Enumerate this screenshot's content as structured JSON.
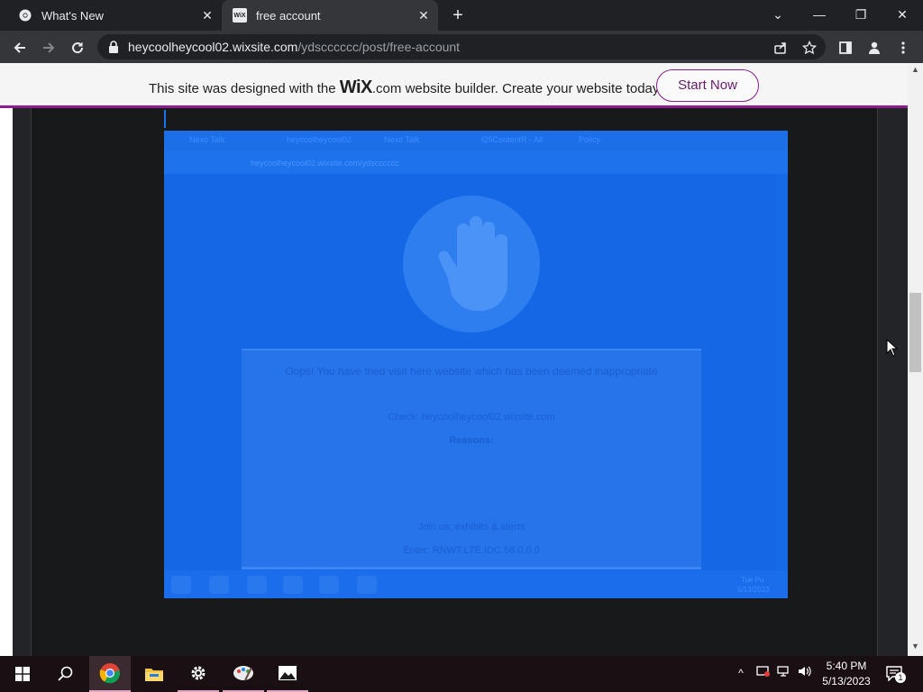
{
  "browser": {
    "tabs": [
      {
        "title": "What's New",
        "icon": "chrome-icon"
      },
      {
        "title": "free account",
        "icon": "wix-favicon",
        "favicon_text": "WiX"
      }
    ],
    "new_tab_symbol": "+",
    "window_controls": {
      "tab_search": "⌄",
      "minimize": "—",
      "restore": "❐",
      "close": "✕"
    },
    "url_host": "heycoolheycool02.wixsite.com",
    "url_path": "/ydscccccc/post/free-account"
  },
  "wix_banner": {
    "text_before": "This site was designed with the ",
    "brand": "WiX",
    "text_after": ".com website builder. Create your website today.",
    "button_label": "Start Now",
    "accent_color": "#8e1b8f"
  },
  "embedded_screenshot": {
    "tabs": [
      "Nexo Talk",
      "heycoolheycool02",
      "Nexo Talk",
      "f25ContentR - All",
      "Policy"
    ],
    "url": "heycoolheycool02.wixsite.com/ydscccccc",
    "card_lines": [
      "Oops! You have tried visit here website which has been deemed inappropriate",
      "Check: heycoolheycool02.wixsite.com",
      "Reasons:",
      "",
      "",
      "Join us: exhibits & alerts",
      "Enter: RNWT.LTE.IDC.58.0.0.0"
    ],
    "taskbar_time": "Tue Pu",
    "taskbar_date": "5/13/2023"
  },
  "taskbar": {
    "apps": [
      "windows-start-icon",
      "search-icon",
      "chrome-icon",
      "file-explorer-icon",
      "settings-icon",
      "paint-icon",
      "photos-icon"
    ],
    "time": "5:40 PM",
    "date": "5/13/2023",
    "notification_count": "1"
  }
}
